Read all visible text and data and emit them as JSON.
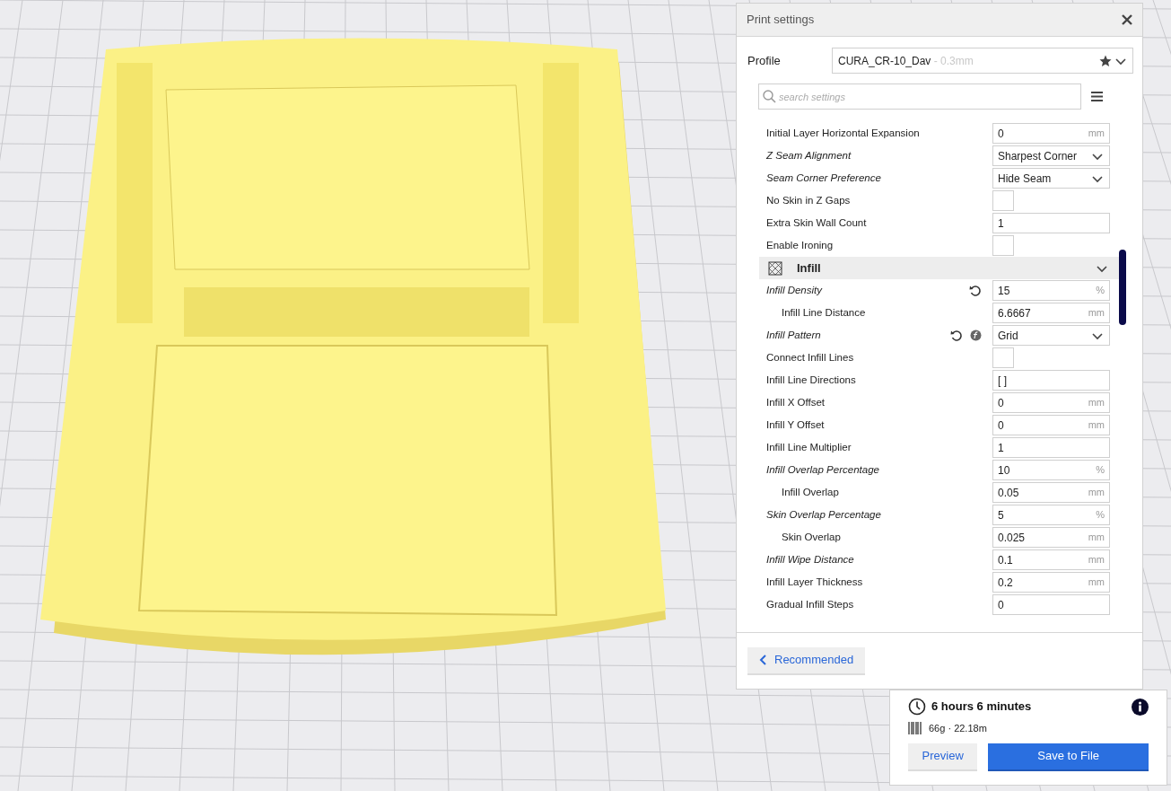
{
  "panel": {
    "title": "Print settings",
    "profile_label": "Profile",
    "profile_name": "CURA_CR-10_Dav",
    "profile_layer": " - 0.3mm",
    "search_placeholder": "search settings"
  },
  "settings": [
    {
      "kind": "number",
      "label": "Initial Layer Horizontal Expansion",
      "modified": false,
      "value": "0",
      "unit": "mm"
    },
    {
      "kind": "dropdown",
      "label": "Z Seam Alignment",
      "modified": true,
      "value": "Sharpest Corner"
    },
    {
      "kind": "dropdown",
      "label": "Seam Corner Preference",
      "modified": true,
      "value": "Hide Seam"
    },
    {
      "kind": "checkbox",
      "label": "No Skin in Z Gaps",
      "modified": false,
      "checked": false
    },
    {
      "kind": "number",
      "label": "Extra Skin Wall Count",
      "modified": false,
      "value": "1"
    },
    {
      "kind": "checkbox",
      "label": "Enable Ironing",
      "modified": false,
      "checked": false
    },
    {
      "kind": "category",
      "label": "Infill",
      "expanded": true
    },
    {
      "kind": "number",
      "label": "Infill Density",
      "modified": true,
      "reset": true,
      "value": "15",
      "unit": "%",
      "children": [
        {
          "kind": "number",
          "label": "Infill Line Distance",
          "modified": false,
          "value": "6.6667",
          "unit": "mm"
        }
      ]
    },
    {
      "kind": "dropdown",
      "label": "Infill Pattern",
      "modified": true,
      "reset": true,
      "formula": true,
      "value": "Grid"
    },
    {
      "kind": "checkbox",
      "label": "Connect Infill Lines",
      "modified": false,
      "checked": false
    },
    {
      "kind": "number",
      "label": "Infill Line Directions",
      "modified": false,
      "value": "[ ]"
    },
    {
      "kind": "number",
      "label": "Infill X Offset",
      "modified": false,
      "value": "0",
      "unit": "mm"
    },
    {
      "kind": "number",
      "label": "Infill Y Offset",
      "modified": false,
      "value": "0",
      "unit": "mm"
    },
    {
      "kind": "number",
      "label": "Infill Line Multiplier",
      "modified": false,
      "value": "1"
    },
    {
      "kind": "number",
      "label": "Infill Overlap Percentage",
      "modified": true,
      "value": "10",
      "unit": "%",
      "children": [
        {
          "kind": "number",
          "label": "Infill Overlap",
          "modified": false,
          "value": "0.05",
          "unit": "mm"
        }
      ]
    },
    {
      "kind": "number",
      "label": "Skin Overlap Percentage",
      "modified": true,
      "value": "5",
      "unit": "%",
      "children": [
        {
          "kind": "number",
          "label": "Skin Overlap",
          "modified": false,
          "value": "0.025",
          "unit": "mm"
        }
      ]
    },
    {
      "kind": "number",
      "label": "Infill Wipe Distance",
      "modified": true,
      "value": "0.1",
      "unit": "mm"
    },
    {
      "kind": "number",
      "label": "Infill Layer Thickness",
      "modified": false,
      "value": "0.2",
      "unit": "mm"
    },
    {
      "kind": "number",
      "label": "Gradual Infill Steps",
      "modified": false,
      "value": "0"
    }
  ],
  "recommended_button": "Recommended",
  "estimate": {
    "time": "6 hours 6 minutes",
    "material": "66g · 22.18m",
    "preview_button": "Preview",
    "save_button": "Save to File"
  }
}
